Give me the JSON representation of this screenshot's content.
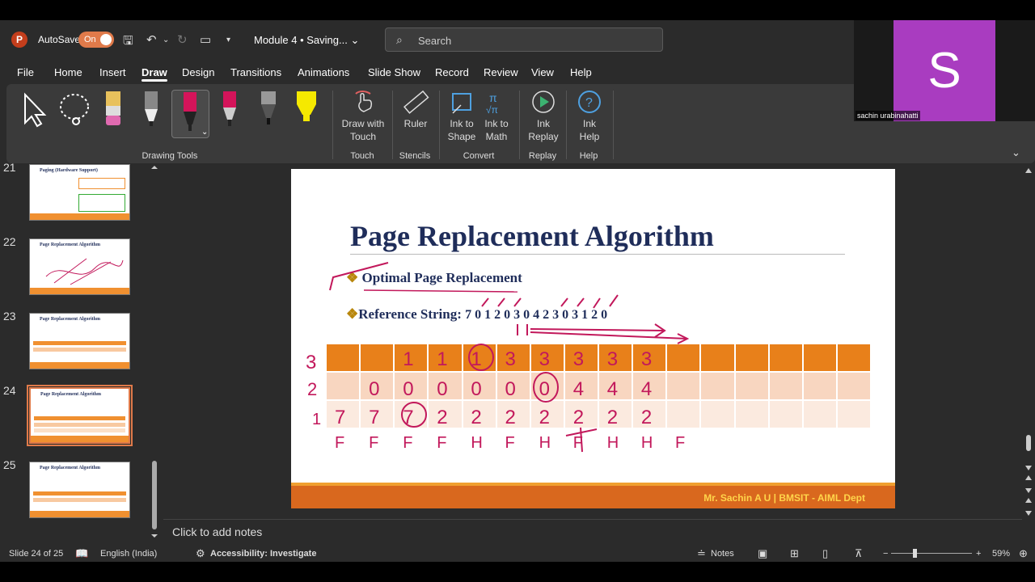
{
  "app": {
    "autosave_label": "AutoSave",
    "autosave_state": "On",
    "doc_title": "Module 4 • Saving...",
    "doc_title_chevron": "⌄",
    "search_placeholder": "Search"
  },
  "menu": [
    "File",
    "Home",
    "Insert",
    "Draw",
    "Design",
    "Transitions",
    "Animations",
    "Slide Show",
    "Record",
    "Review",
    "View",
    "Help"
  ],
  "ribbon": {
    "draw_with_touch": "Draw with Touch",
    "ruler": "Ruler",
    "ink_to_shape": "Ink to Shape",
    "ink_to_math": "Ink to Math",
    "ink_replay": "Ink Replay",
    "ink_help": "Ink Help",
    "groups": {
      "drawing_tools": "Drawing Tools",
      "touch": "Touch",
      "stencils": "Stencils",
      "convert": "Convert",
      "replay": "Replay",
      "help": "Help"
    },
    "colors": {
      "pen_pink": "#d4145a",
      "pen_gray": "#888888",
      "highlighter_yellow": "#f5e900",
      "highlighter_pink": "#e06ab0"
    }
  },
  "video": {
    "initial": "S",
    "name": "sachin urabinahatti",
    "color": "#a93cc0"
  },
  "thumbnails": [
    {
      "num": "21",
      "title": "Paging (Hardware Support)"
    },
    {
      "num": "22",
      "title": "Page Replacement Algorithm"
    },
    {
      "num": "23",
      "title": "Page Replacement Algorithm"
    },
    {
      "num": "24",
      "title": "Page Replacement Algorithm"
    },
    {
      "num": "25",
      "title": "Page Replacement Algorithm"
    }
  ],
  "slide": {
    "title": "Page Replacement Algorithm",
    "bullet1": "Optimal Page Replacement",
    "bullet2_label": "Reference String:",
    "bullet2_value": "7 0 1 2 0 3 0 4 2 3 0 3 1 2 0",
    "bullet_mark": "❖",
    "footer": "Mr. Sachin A U | BMSIT - AIML Dept",
    "ink_color": "#c2185b",
    "ink": {
      "frame_labels": [
        "3",
        "2",
        "1"
      ],
      "row3": [
        "",
        "",
        "1",
        "1",
        "1",
        "3",
        "3",
        "3",
        "3",
        "3"
      ],
      "row2": [
        "",
        "0",
        "0",
        "0",
        "0",
        "0",
        "0",
        "4",
        "4",
        "4"
      ],
      "row1": [
        "7",
        "7",
        "7",
        "2",
        "2",
        "2",
        "2",
        "2",
        "2",
        "2"
      ],
      "faults": [
        "F",
        "F",
        "F",
        "F",
        "H",
        "F",
        "H",
        "F",
        "H",
        "H",
        "F"
      ]
    }
  },
  "notes_placeholder": "Click to add notes",
  "status": {
    "slide_info": "Slide 24 of 25",
    "language": "English (India)",
    "accessibility": "Accessibility: Investigate",
    "notes": "Notes",
    "zoom": "59%"
  }
}
